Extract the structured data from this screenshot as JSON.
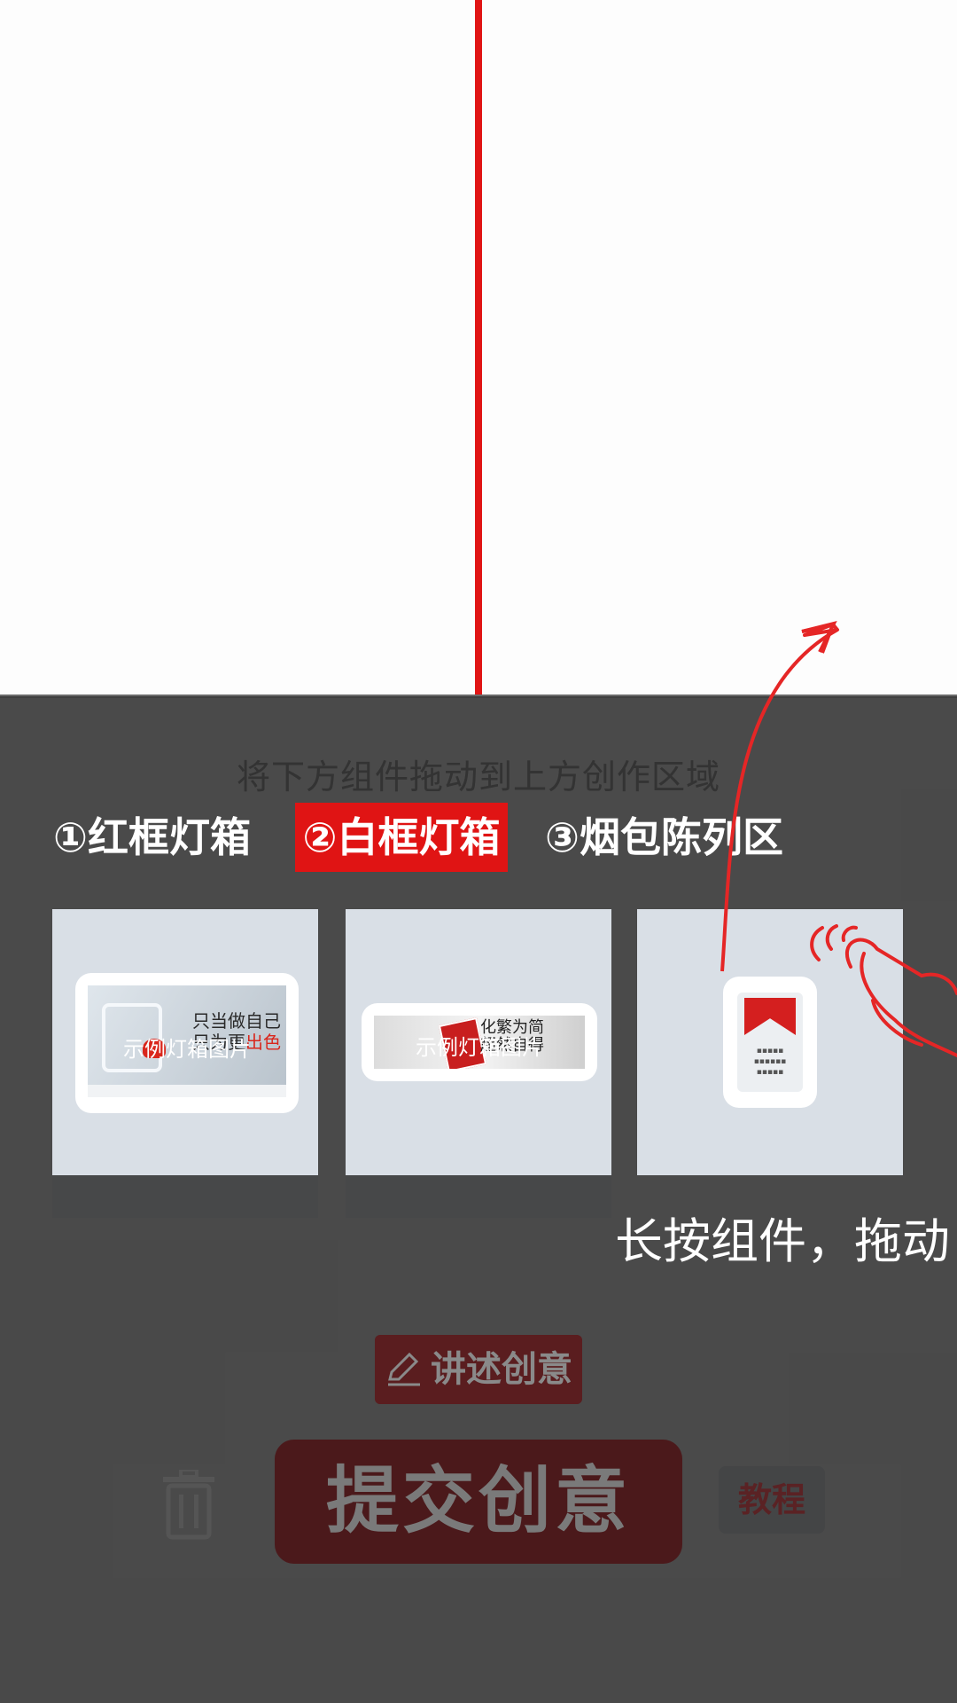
{
  "canvas": {
    "line_color": "#e01515"
  },
  "panel": {
    "hint": "将下方组件拖动到上方创作区域",
    "tabs": [
      {
        "label": "①红框灯箱",
        "selected": false
      },
      {
        "label": "②白框灯箱",
        "selected": true
      },
      {
        "label": "③烟包陈列区",
        "selected": false
      }
    ],
    "cards": [
      {
        "caption": "示例灯箱图片",
        "image_text_1": "只当做自己",
        "image_text_2": "只为更",
        "image_text_accent": "出色"
      },
      {
        "caption": "示例灯箱图片",
        "image_text_1": "化繁为简",
        "image_text_2": "超然自得"
      },
      {
        "caption": ""
      }
    ],
    "story_button": "讲述创意",
    "submit_button": "提交创意",
    "tutorial_button": "教程"
  },
  "guide": {
    "text": "长按组件，拖动"
  },
  "colors": {
    "accent": "#e01414",
    "overlay": "#3c3c3c"
  }
}
